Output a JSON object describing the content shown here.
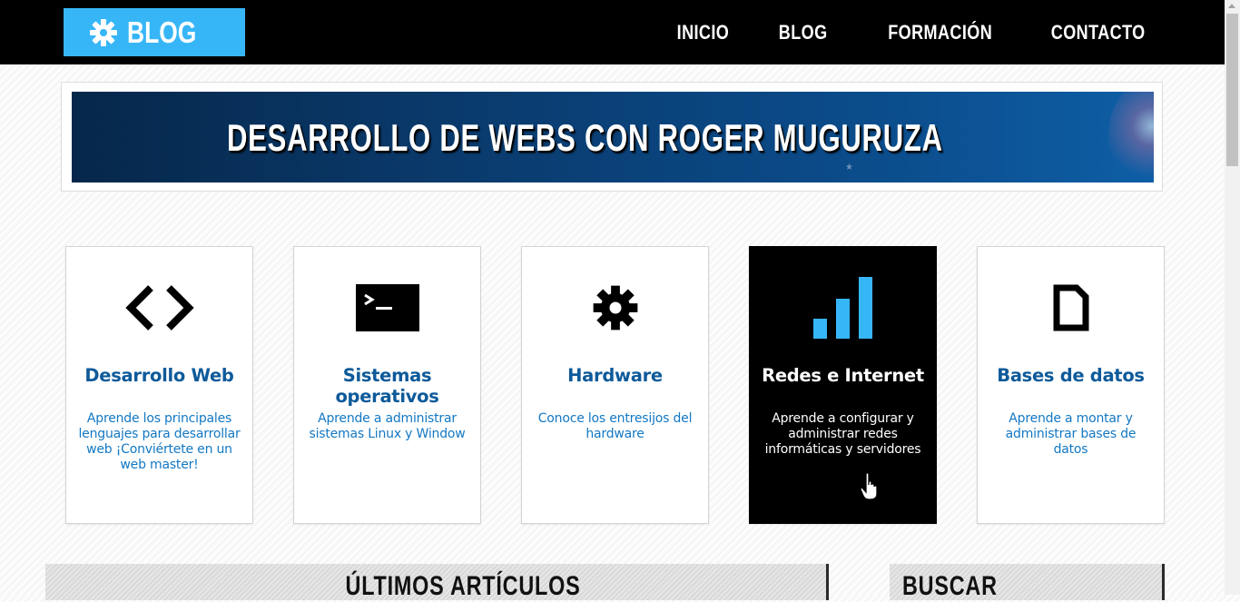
{
  "header": {
    "logo_text": "BLOG",
    "nav": [
      "INICIO",
      "BLOG",
      "FORMACIÓN",
      "CONTACTO"
    ]
  },
  "banner": {
    "title": "DESARROLLO DE WEBS CON ROGER MUGURUZA"
  },
  "cards": [
    {
      "icon": "code-brackets-icon",
      "title": "Desarrollo Web",
      "text": "Aprende los principales lenguajes para desarrollar web ¡Conviértete en un web master!"
    },
    {
      "icon": "terminal-icon",
      "title": "Sistemas operativos",
      "text": "Aprende a administrar sistemas Linux y Window"
    },
    {
      "icon": "gear-icon",
      "title": "Hardware",
      "text": "Conoce los entresijos del hardware"
    },
    {
      "icon": "signal-bars-icon",
      "title": "Redes e Internet",
      "text": "Aprende a configurar y administrar redes informáticas y servidores",
      "active": true
    },
    {
      "icon": "document-icon",
      "title": "Bases de datos",
      "text": "Aprende a montar y administrar bases de datos"
    }
  ],
  "sections": {
    "latest_title": "ÚLTIMOS ARTÍCULOS",
    "search_title": "BUSCAR"
  },
  "colors": {
    "accent": "#37b6f7",
    "link": "#0d5a9a",
    "header_bg": "#000000"
  }
}
